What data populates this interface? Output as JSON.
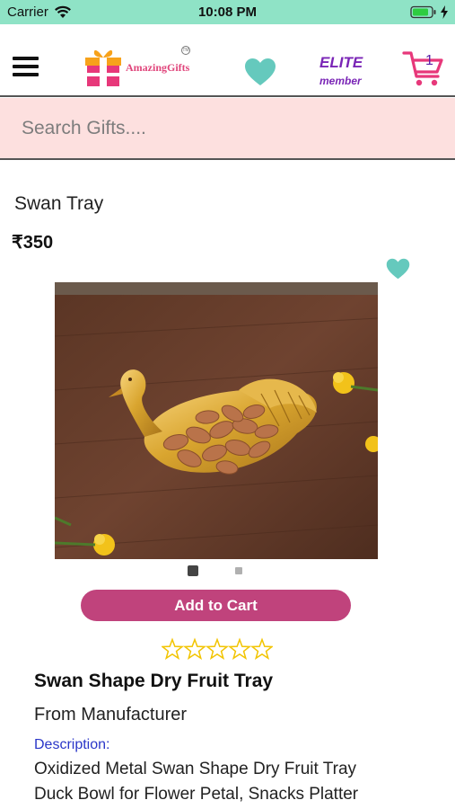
{
  "status_bar": {
    "carrier": "Carrier",
    "time": "10:08 PM",
    "background": "#8fe3c6"
  },
  "header": {
    "menu_icon": "hamburger-menu-icon",
    "logo_text": "AmazingGifts",
    "logo_mark": "TM",
    "wishlist_icon": "heart-icon",
    "membership_title": "ELITE",
    "membership_subtitle": "member",
    "cart_count": "1",
    "brand_pink": "#e0457b",
    "elite_purple": "#7a25b6"
  },
  "search": {
    "placeholder": "Search Gifts....",
    "value": "",
    "background": "#fde0df"
  },
  "product": {
    "name": "Swan Tray",
    "price": "₹350",
    "image_description_icon": "swan-tray-photo",
    "carousel": {
      "total": 2,
      "active": 1
    },
    "add_to_cart_label": "Add to Cart",
    "button_color": "#c0437c",
    "rating": {
      "value": 0,
      "max": 5,
      "star_color": "#f2c400"
    },
    "title": "Swan Shape Dry Fruit Tray",
    "source": "From Manufacturer",
    "description_label": "Description:",
    "description_lines": [
      "Oxidized Metal Swan Shape Dry Fruit Tray",
      "Duck Bowl for Flower Petal, Snacks Platter"
    ]
  }
}
